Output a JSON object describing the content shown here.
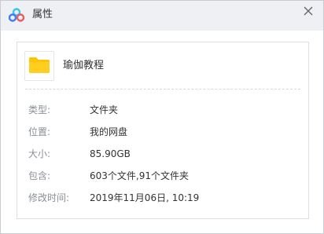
{
  "window": {
    "title": "属性",
    "app_icon": "baidu-netdisk-cloud-icon",
    "close_icon": "close-icon",
    "colors": {
      "titlebar": "#eef0f4",
      "folder": "#ffc400",
      "logo_blue": "#3b7cf4",
      "logo_cyan": "#35c3ef",
      "logo_red": "#f0595f"
    }
  },
  "file": {
    "icon": "folder-icon",
    "name": "瑜伽教程"
  },
  "properties": [
    {
      "label": "类型:",
      "value": "文件夹"
    },
    {
      "label": "位置:",
      "value": "我的网盘"
    },
    {
      "label": "大小:",
      "value": "85.90GB"
    },
    {
      "label": "包含:",
      "value": "603个文件,91个文件夹"
    },
    {
      "label": "修改时间:",
      "value": "2019年11月06日, 10:19"
    }
  ]
}
